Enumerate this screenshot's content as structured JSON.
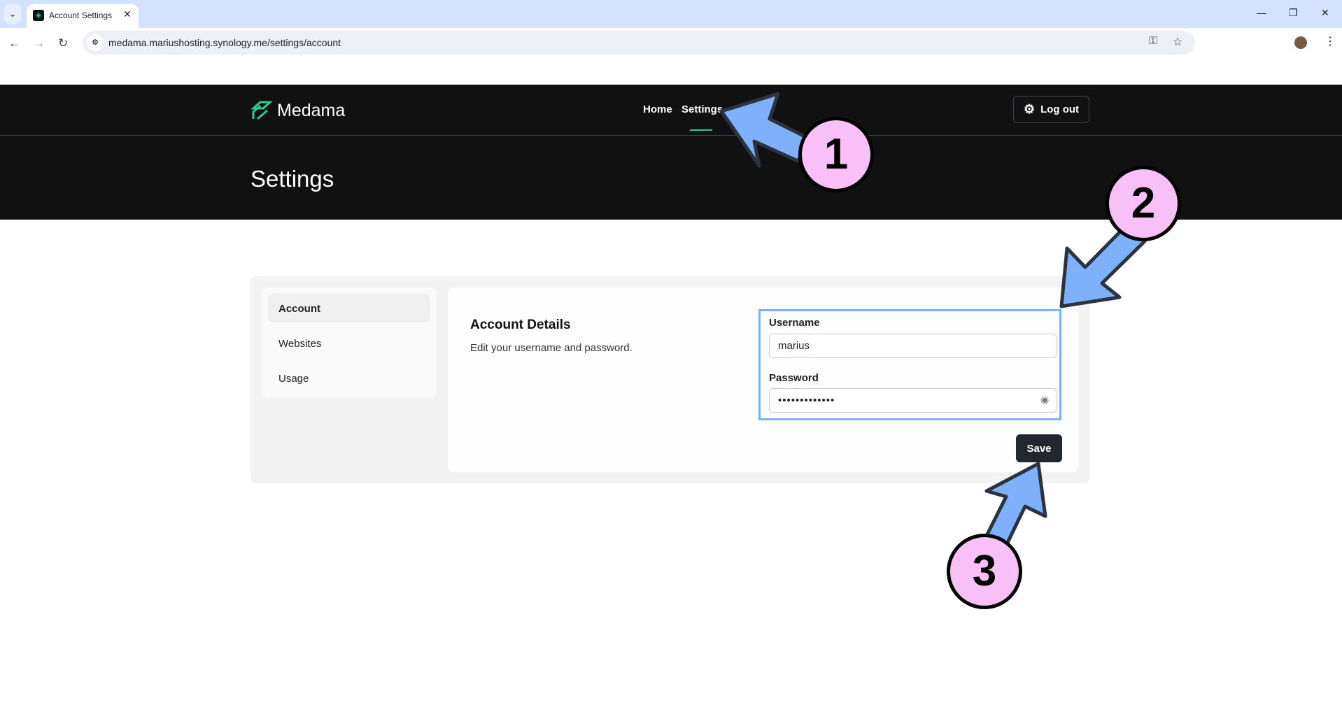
{
  "browser": {
    "tab_title": "Account Settings",
    "url": "medama.mariushosting.synology.me/settings/account"
  },
  "header": {
    "brand": "Medama",
    "nav": [
      {
        "label": "Home"
      },
      {
        "label": "Settings",
        "active": true
      }
    ],
    "logout_label": "Log out",
    "page_title": "Settings"
  },
  "sidebar": {
    "items": [
      {
        "label": "Account",
        "active": true
      },
      {
        "label": "Websites"
      },
      {
        "label": "Usage"
      }
    ]
  },
  "main": {
    "title": "Account Details",
    "subtitle": "Edit your username and password.",
    "username_label": "Username",
    "username_value": "marius",
    "password_label": "Password",
    "password_value": "•••••••••••••",
    "save_label": "Save"
  },
  "annotations": {
    "steps": [
      "1",
      "2",
      "3"
    ],
    "arrow_color": "#7eb1fa",
    "circle_color": "#f9c0f7"
  },
  "colors": {
    "accent": "#2ecc8f",
    "header_bg": "#111111"
  }
}
